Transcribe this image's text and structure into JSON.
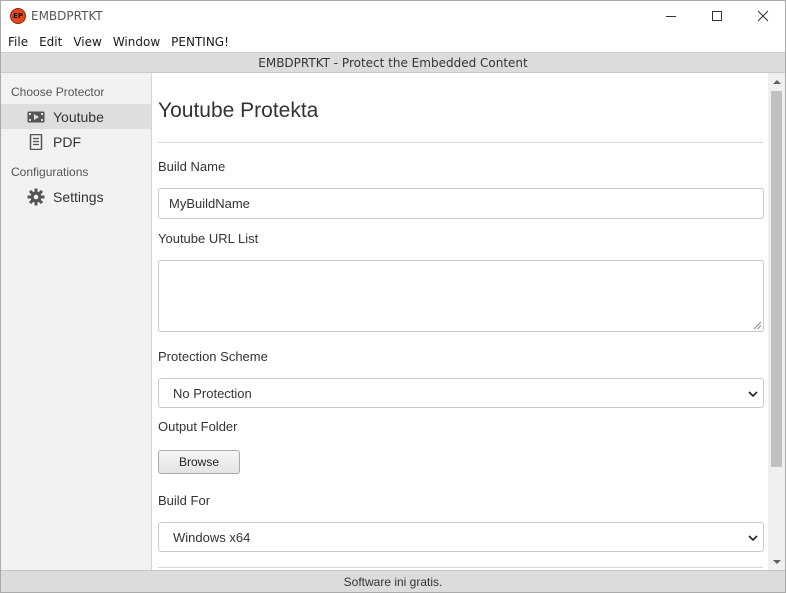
{
  "window": {
    "title": "EMBDPRTKT",
    "icon_text": "EP",
    "accent_color": "#e8471c"
  },
  "menu": {
    "items": [
      "File",
      "Edit",
      "View",
      "Window",
      "PENTING!"
    ]
  },
  "header": {
    "text": "EMBDPRTKT - Protect the Embedded Content"
  },
  "sidebar": {
    "section_protector": "Choose Protector",
    "items": [
      {
        "label": "Youtube",
        "icon": "video-icon",
        "active": true
      },
      {
        "label": "PDF",
        "icon": "document-icon",
        "active": false
      }
    ],
    "section_config": "Configurations",
    "config_items": [
      {
        "label": "Settings",
        "icon": "gear-icon"
      }
    ]
  },
  "main": {
    "title": "Youtube Protekta",
    "build_name": {
      "label": "Build Name",
      "value": "MyBuildName"
    },
    "url_list": {
      "label": "Youtube URL List",
      "value": ""
    },
    "protection": {
      "label": "Protection Scheme",
      "selected": "No Protection"
    },
    "output": {
      "label": "Output Folder",
      "button": "Browse"
    },
    "build_for": {
      "label": "Build For",
      "selected": "Windows x64"
    }
  },
  "status": {
    "text": "Software ini gratis."
  }
}
